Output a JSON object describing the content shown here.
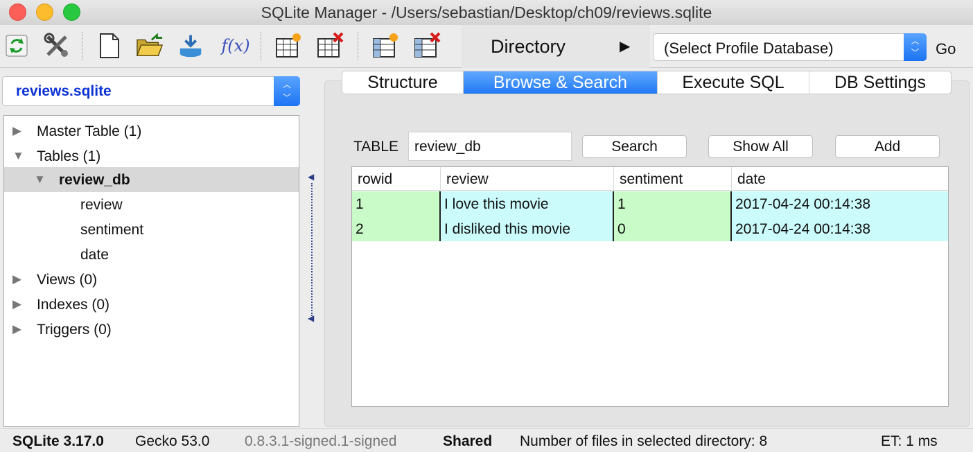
{
  "window": {
    "title": "SQLite Manager - /Users/sebastian/Desktop/ch09/reviews.sqlite"
  },
  "toolbar": {
    "buttons": [
      {
        "name": "refresh-icon"
      },
      {
        "name": "settings-tools-icon"
      },
      {
        "name": "new-database-icon"
      },
      {
        "name": "open-database-icon"
      },
      {
        "name": "import-icon"
      },
      {
        "name": "function-icon",
        "glyph": "f(x)"
      },
      {
        "name": "create-table-icon"
      },
      {
        "name": "drop-table-icon"
      },
      {
        "name": "create-index-icon"
      },
      {
        "name": "drop-index-icon"
      }
    ],
    "directory_label": "Directory",
    "directory_arrow": "▶",
    "profile_select_value": "(Select Profile Database)",
    "go_label": "Go"
  },
  "left": {
    "database_select_value": "reviews.sqlite",
    "tree": [
      {
        "label": "Master Table (1)",
        "level": 0,
        "arrow": "▶"
      },
      {
        "label": "Tables (1)",
        "level": 0,
        "arrow": "▼"
      },
      {
        "label": "review_db",
        "level": 1,
        "arrow": "▼",
        "selected": true
      },
      {
        "label": "review",
        "level": 2,
        "arrow": ""
      },
      {
        "label": "sentiment",
        "level": 2,
        "arrow": ""
      },
      {
        "label": "date",
        "level": 2,
        "arrow": ""
      },
      {
        "label": "Views (0)",
        "level": 0,
        "arrow": "▶"
      },
      {
        "label": "Indexes (0)",
        "level": 0,
        "arrow": "▶"
      },
      {
        "label": "Triggers (0)",
        "level": 0,
        "arrow": "▶"
      }
    ]
  },
  "tabs": [
    {
      "label": "Structure",
      "active": false
    },
    {
      "label": "Browse & Search",
      "active": true
    },
    {
      "label": "Execute SQL",
      "active": false
    },
    {
      "label": "DB Settings",
      "active": false
    }
  ],
  "browse": {
    "table_label": "TABLE",
    "table_value": "review_db",
    "search_label": "Search",
    "show_all_label": "Show All",
    "add_label": "Add",
    "columns": [
      "rowid",
      "review",
      "sentiment",
      "date"
    ],
    "rows": [
      [
        "1",
        "I love this movie",
        "1",
        "2017-04-24 00:14:38"
      ],
      [
        "2",
        "I disliked this movie",
        "0",
        "2017-04-24 00:14:38"
      ]
    ]
  },
  "status": {
    "sqlite_version": "SQLite 3.17.0",
    "gecko_version": "Gecko 53.0",
    "addon_version": "0.8.3.1-signed.1-signed",
    "mode": "Shared",
    "files_count": "Number of files in selected directory: 8",
    "elapsed": "ET: 1 ms"
  }
}
